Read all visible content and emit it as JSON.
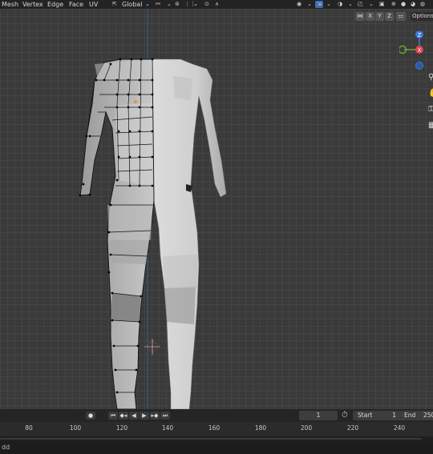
{
  "menu": [
    "Mesh",
    "Vertex",
    "Edge",
    "Face",
    "UV"
  ],
  "header": {
    "transform_orientation": "Global"
  },
  "viewport_header": {
    "axes": [
      "X",
      "Y",
      "Z"
    ],
    "options_label": "Options"
  },
  "gizmo": {
    "top_axis": "Z",
    "center_axis": "X"
  },
  "timeline": {
    "current_frame": "1",
    "start_label": "Start",
    "start_value": "1",
    "end_label": "End",
    "end_value": "250"
  },
  "ruler_ticks": [
    "80",
    "100",
    "120",
    "140",
    "160",
    "180",
    "200",
    "220",
    "240"
  ],
  "status": {
    "text": "dd"
  },
  "colors": {
    "origin": "#e8903a",
    "axis_line": "#2f5b8c",
    "gizmo_x": "#e0444a",
    "gizmo_y": "#6aa330",
    "gizmo_z": "#3a78d8"
  }
}
